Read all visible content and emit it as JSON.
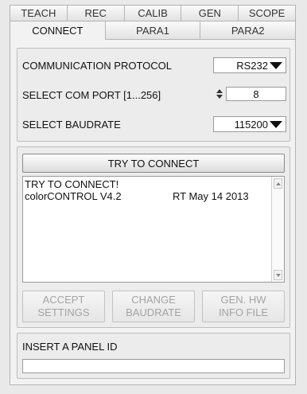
{
  "tabs_top": [
    "TEACH",
    "REC",
    "CALIB",
    "GEN",
    "SCOPE"
  ],
  "tabs_bottom": [
    "CONNECT",
    "PARA1",
    "PARA2"
  ],
  "active_tab": "CONNECT",
  "comm": {
    "protocol_label": "COMMUNICATION PROTOCOL",
    "protocol_value": "RS232",
    "port_label": "SELECT COM PORT [1...256]",
    "port_value": "8",
    "baud_label": "SELECT BAUDRATE",
    "baud_value": "115200"
  },
  "connect": {
    "button_label": "TRY TO CONNECT",
    "log_line1": "TRY TO CONNECT!",
    "log_line2_left": "colorCONTROL V4.2",
    "log_line2_right": "RT May 14 2013"
  },
  "actions": {
    "accept_line1": "ACCEPT",
    "accept_line2": "SETTINGS",
    "change_line1": "CHANGE",
    "change_line2": "BAUDRATE",
    "genhw_line1": "GEN. HW",
    "genhw_line2": "INFO FILE"
  },
  "panel_id": {
    "label": "INSERT A PANEL ID",
    "value": ""
  },
  "colors": {
    "background": "#e9e9e9",
    "panel": "#f2f2f2",
    "disabled_text": "#a3a3a3"
  }
}
